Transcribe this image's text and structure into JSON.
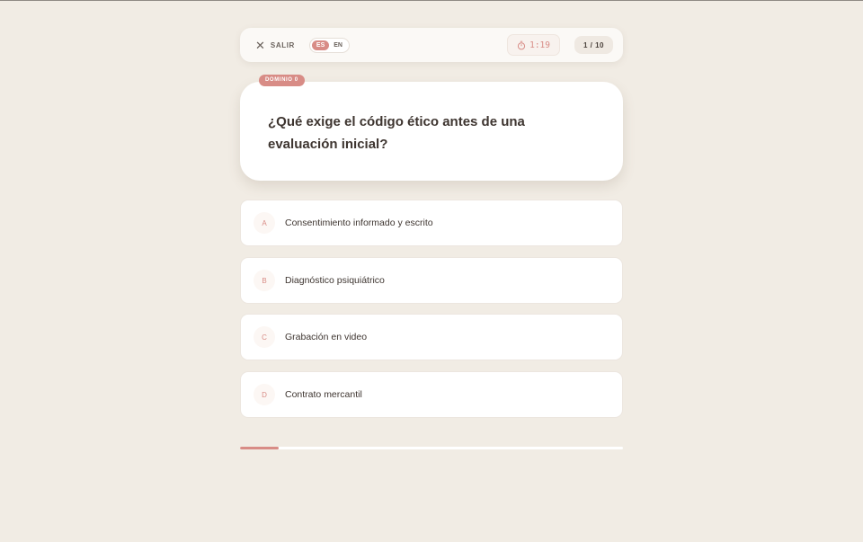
{
  "topbar": {
    "exit_label": "SALIR",
    "languages": [
      "ES",
      "EN"
    ],
    "active_language": "ES",
    "timer": "1:19",
    "counter": "1 / 10"
  },
  "question": {
    "domain_tag": "DOMINIO 0",
    "text": "¿Qué exige el código ético antes de una evaluación inicial?"
  },
  "options": [
    {
      "letter": "A",
      "text": "Consentimiento informado y escrito"
    },
    {
      "letter": "B",
      "text": "Diagnóstico psiquiátrico"
    },
    {
      "letter": "C",
      "text": "Grabación en video"
    },
    {
      "letter": "D",
      "text": "Contrato mercantil"
    }
  ],
  "progress": {
    "fraction": 0.1
  },
  "icons": {
    "exit": "close-icon",
    "timer": "stopwatch-icon"
  },
  "colors": {
    "accent": "#d88c86",
    "background": "#f1ece4",
    "text": "#3e3530"
  }
}
